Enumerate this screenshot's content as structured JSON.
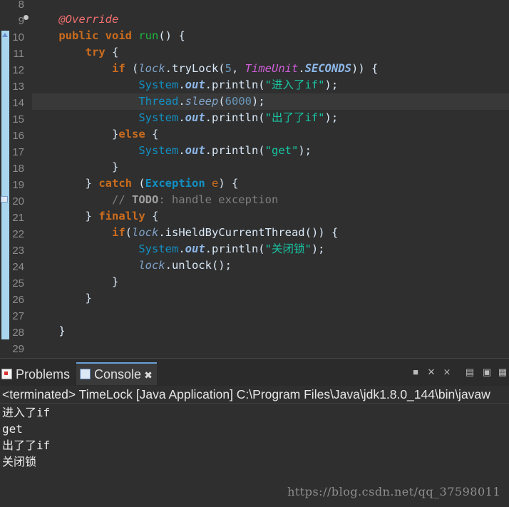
{
  "editor": {
    "line_numbers": [
      "8",
      "9",
      "10",
      "11",
      "12",
      "13",
      "14",
      "15",
      "16",
      "17",
      "18",
      "19",
      "20",
      "21",
      "22",
      "23",
      "24",
      "25",
      "26",
      "27",
      "28",
      "29"
    ],
    "code": {
      "l9": {
        "annotation": "@Override"
      },
      "l10": {
        "kw_public": "public",
        "kw_void": "void",
        "method": "run",
        "rest": "() {"
      },
      "l11": {
        "kw_try": "try",
        "rest": " {"
      },
      "l12": {
        "kw_if": "if",
        "p1": " (",
        "lock": "lock",
        "call": ".tryLock(",
        "num": "5",
        "comma": ", ",
        "cls": "TimeUnit",
        "dot": ".",
        "enum": "SECONDS",
        "tail": ")) {"
      },
      "l13": {
        "cls": "System",
        "dot": ".",
        "fld": "out",
        "call": ".println(",
        "str": "\"进入了if\"",
        "tail": ");"
      },
      "l14": {
        "cls": "Thread",
        "dot": ".",
        "sm": "sleep",
        "p": "(",
        "num": "6000",
        "tail": ");"
      },
      "l15": {
        "cls": "System",
        "dot": ".",
        "fld": "out",
        "call": ".println(",
        "str": "\"出了了if\"",
        "tail": ");"
      },
      "l16": {
        "pre": "}",
        "kw_else": "else",
        "tail": " {"
      },
      "l17": {
        "cls": "System",
        "dot": ".",
        "fld": "out",
        "call": ".println(",
        "str": "\"get\"",
        "tail": ");"
      },
      "l18": {
        "text": "}"
      },
      "l19": {
        "pre": "} ",
        "kw_catch": "catch",
        "p": " (",
        "cls": "Exception",
        "sp": " ",
        "var": "e",
        "tail": ") {"
      },
      "l20": {
        "slashes": "// ",
        "todo": "TODO",
        "rest": ": handle exception"
      },
      "l21": {
        "pre": "} ",
        "kw_finally": "finally",
        "tail": " {"
      },
      "l22": {
        "kw_if": "if",
        "p": "(",
        "lock": "lock",
        "call": ".isHeldByCurrentThread",
        "tail": "()) {"
      },
      "l23": {
        "cls": "System",
        "dot": ".",
        "fld": "out",
        "call": ".println(",
        "str": "\"关闭锁\"",
        "tail": ");"
      },
      "l24": {
        "lock": "lock",
        "call": ".unlock",
        "tail": "();"
      },
      "l25": {
        "text": "}"
      },
      "l26": {
        "text": "}"
      },
      "l28": {
        "text": "}"
      }
    }
  },
  "panel": {
    "tabs": [
      {
        "label": "Problems"
      },
      {
        "label": "Console"
      }
    ],
    "close_glyph": "✖",
    "toolbar_icons": [
      "stop-icon",
      "remove-launch-icon",
      "remove-all-icon",
      "scroll-lock-icon",
      "show-console-icon",
      "pin-console-icon"
    ]
  },
  "console": {
    "header": "<terminated> TimeLock [Java Application] C:\\Program Files\\Java\\jdk1.8.0_144\\bin\\javaw",
    "output": [
      "进入了if",
      "get",
      "出了了if",
      "关闭锁"
    ]
  },
  "watermark": "https://blog.csdn.net/qq_37598011"
}
